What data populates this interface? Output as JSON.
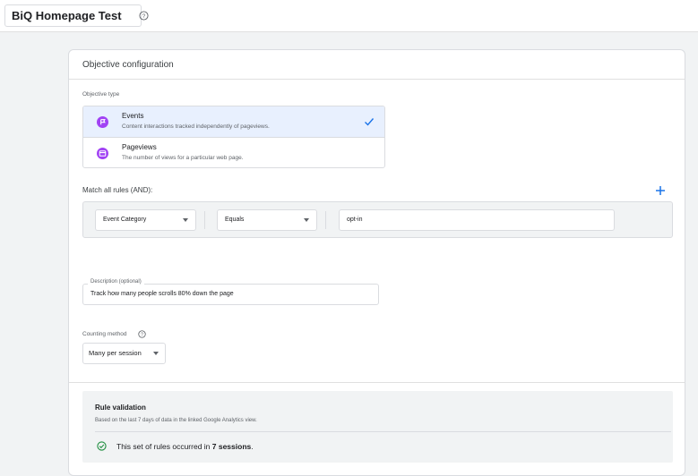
{
  "header": {
    "experiment_name": "BiQ Homepage Test",
    "help_icon": "help-circle-icon"
  },
  "objective": {
    "title": "Objective configuration",
    "type_label": "Objective type",
    "options": [
      {
        "label": "Events",
        "description": "Content interactions tracked independently of pageviews.",
        "icon": "events-flag-icon",
        "selected": true
      },
      {
        "label": "Pageviews",
        "description": "The number of views for a particular web page.",
        "icon": "pageview-window-icon",
        "selected": false
      }
    ],
    "accent_color": "#a142f4",
    "selected_bg": "#e8f0fe",
    "check_color": "#1a73e8"
  },
  "rules": {
    "label": "Match all rules (AND):",
    "add_icon": "plus-icon",
    "field": "Event Category",
    "operator": "Equals",
    "value": "opt-in"
  },
  "description": {
    "label": "Description (optional)",
    "value": "Track how many people scrolls 80% down the page"
  },
  "counting": {
    "label": "Counting method",
    "value": "Many per session"
  },
  "validation": {
    "title": "Rule validation",
    "subtitle": "Based on the last 7 days of data in the linked Google Analytics view.",
    "result_prefix": "This set of rules occurred in ",
    "result_count": "7 sessions",
    "result_suffix": ".",
    "ok_color": "#1e8e3e"
  }
}
